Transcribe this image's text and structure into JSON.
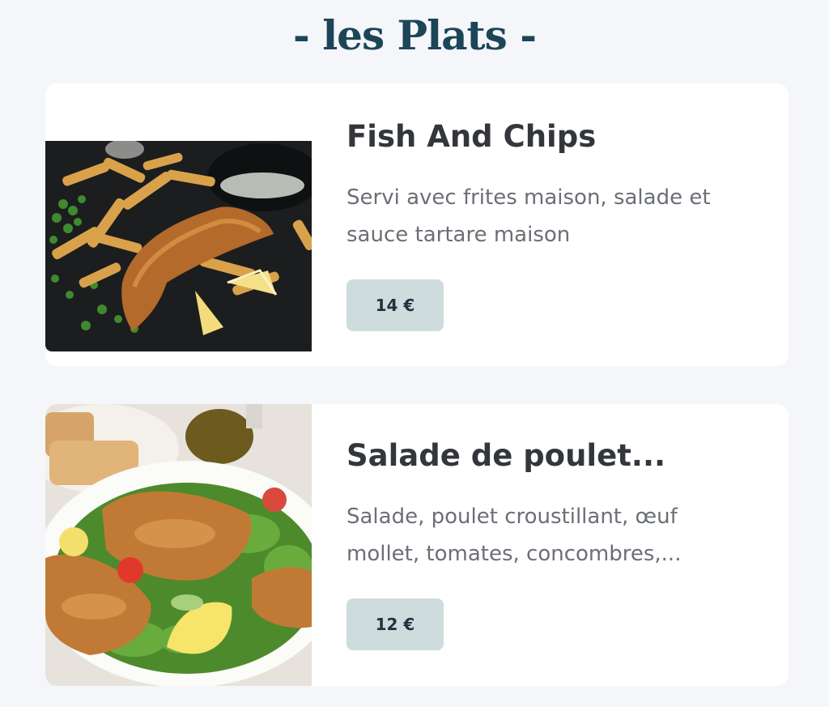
{
  "section": {
    "title": "- les Plats -"
  },
  "dishes": [
    {
      "name": "Fish And Chips",
      "description": "Servi avec frites maison, salade et sauce tartare maison",
      "price": "14 €"
    },
    {
      "name": "Salade de poulet...",
      "description": "Salade, poulet croustillant, œuf mollet, tomates, concombres,...",
      "price": "12 €"
    }
  ],
  "colors": {
    "background": "#f4f6fa",
    "title": "#1c4658",
    "card": "#ffffff",
    "dish_name": "#33363b",
    "description": "#6b6f76",
    "price_badge": "#cfdcdd",
    "price_text": "#1f3440"
  }
}
